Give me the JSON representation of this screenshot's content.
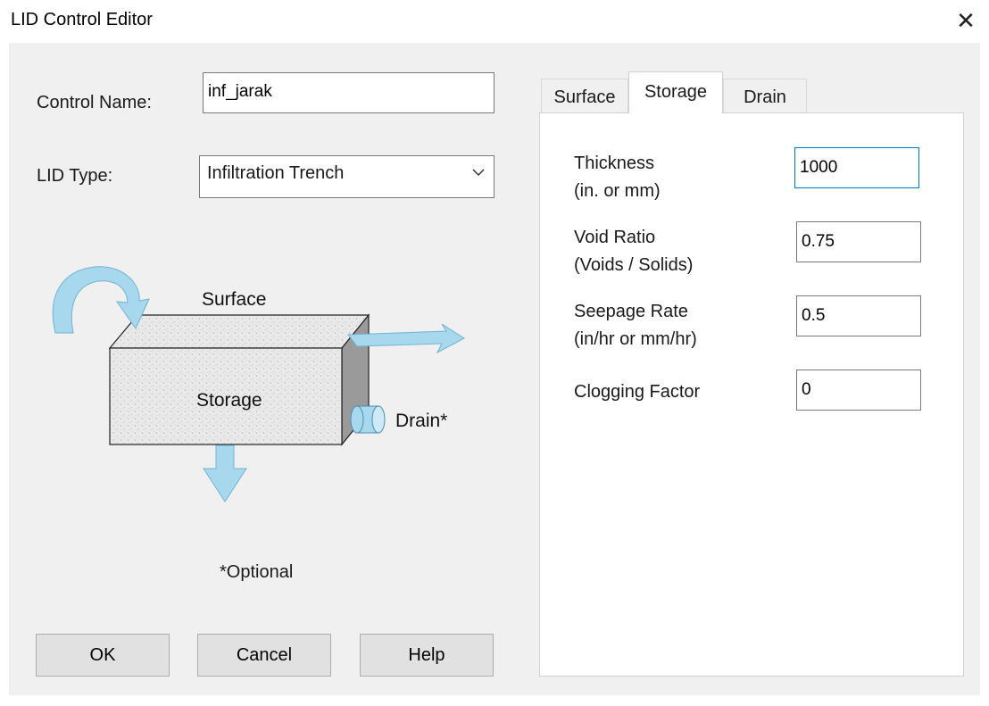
{
  "window": {
    "title": "LID Control Editor",
    "close_glyph": "✕"
  },
  "form": {
    "control_name_label": "Control Name:",
    "control_name_value": "inf_jarak",
    "lid_type_label": "LID Type:",
    "lid_type_value": "Infiltration Trench"
  },
  "diagram": {
    "surface_label": "Surface",
    "storage_label": "Storage",
    "drain_label": "Drain*",
    "optional_note": "*Optional"
  },
  "buttons": {
    "ok": "OK",
    "cancel": "Cancel",
    "help": "Help"
  },
  "tabs": [
    {
      "label": "Surface",
      "active": false
    },
    {
      "label": "Storage",
      "active": true
    },
    {
      "label": "Drain",
      "active": false
    }
  ],
  "storage": {
    "thickness_label": "Thickness",
    "thickness_unit": "(in. or mm)",
    "thickness_value": "1000",
    "void_ratio_label": "Void Ratio",
    "void_ratio_unit": "(Voids / Solids)",
    "void_ratio_value": "0.75",
    "seepage_rate_label": "Seepage Rate",
    "seepage_rate_unit": "(in/hr or mm/hr)",
    "seepage_rate_value": "0.5",
    "clogging_factor_label": "Clogging Factor",
    "clogging_factor_value": "0"
  },
  "colors": {
    "focus_border": "#0078d7",
    "arrow_fill": "#a8d8ee",
    "dialog_bg": "#f0f0f0"
  }
}
